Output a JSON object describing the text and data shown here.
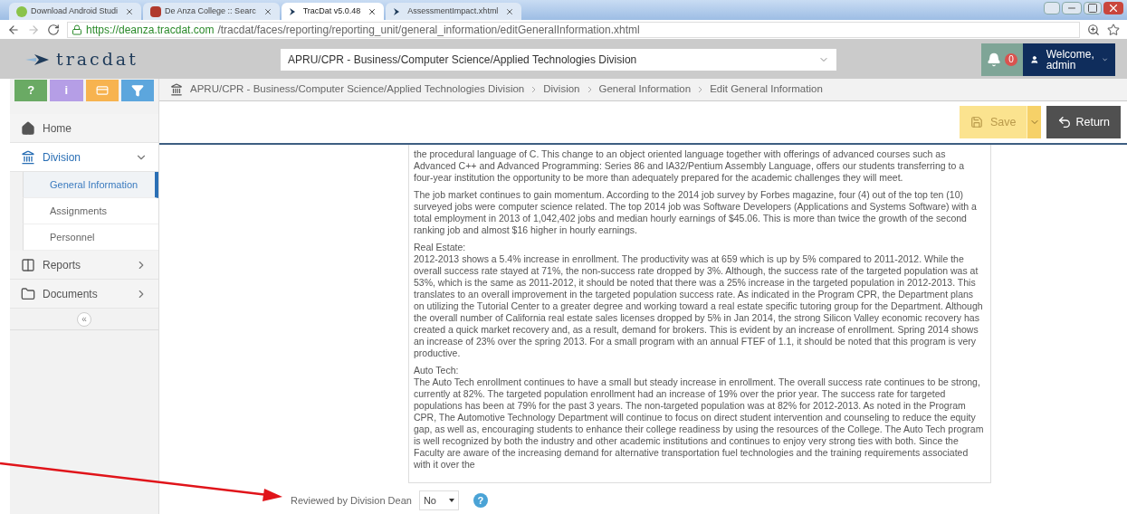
{
  "browser": {
    "tabs": [
      {
        "title": "Download Android Studi",
        "selected": false,
        "kind": "android"
      },
      {
        "title": "De Anza College :: Searc",
        "selected": false,
        "kind": "doc"
      },
      {
        "title": "TracDat v5.0.48",
        "selected": true,
        "kind": "tracdat"
      },
      {
        "title": "AssessmentImpact.xhtml",
        "selected": false,
        "kind": "tracdat"
      }
    ],
    "url": {
      "host": "https://deanza.tracdat.com",
      "path": "/tracdat/faces/reporting/reporting_unit/general_information/editGeneralInformation.xhtml"
    }
  },
  "header": {
    "logo": "tracdat",
    "unit_select": "APRU/CPR - Business/Computer Science/Applied Technologies Division",
    "notifications": "0",
    "welcome": "Welcome,",
    "user": "admin"
  },
  "quick_buttons": [
    {
      "kind": "text",
      "label": "?",
      "color": "#6aaa64"
    },
    {
      "kind": "text",
      "label": "i",
      "color": "#b59ee6"
    },
    {
      "kind": "card",
      "color": "#f7b34f"
    },
    {
      "kind": "filter",
      "color": "#5ca6dd"
    }
  ],
  "breadcrumb": [
    "APRU/CPR - Business/Computer Science/Applied Technologies Division",
    "Division",
    "General Information",
    "Edit General Information"
  ],
  "sidebar": {
    "items": [
      {
        "label": "Home",
        "kind": "home",
        "selected": false
      },
      {
        "label": "Division",
        "kind": "bank",
        "selected": true,
        "expanded": true,
        "children": [
          {
            "label": "General Information",
            "selected": true
          },
          {
            "label": "Assignments",
            "selected": false
          },
          {
            "label": "Personnel",
            "selected": false
          }
        ]
      },
      {
        "label": "Reports",
        "kind": "columns",
        "selected": false,
        "expanded": false
      },
      {
        "label": "Documents",
        "kind": "folder",
        "selected": false,
        "expanded": false
      }
    ],
    "collapse": "«"
  },
  "toolbar": {
    "save": "Save",
    "return": "Return"
  },
  "editor": {
    "paragraphs": [
      {
        "text": "the procedural language of C. This change to an object oriented language together with offerings of advanced courses such as Advanced C++ and Advanced Programming: Series 86 and IA32/Pentium Assembly Language, offers our students transferring to a four-year institution the opportunity to be more than adequately prepared for the academic challenges they will meet."
      },
      {
        "text": "The job market continues to gain momentum.   According to the 2014 job survey by Forbes magazine, four (4) out of the top ten (10) surveyed jobs were computer science related.  The top 2014 job was Software Developers (Applications and Systems Software) with a total employment in 2013 of 1,042,402 jobs and median hourly earnings of $45.06. This is more than twice the growth of the second ranking job and almost $16 higher in hourly earnings."
      },
      {
        "heading": "Real Estate:",
        "text": "2012-2013 shows a 5.4% increase in enrollment. The productivity was at 659 which is up by 5% compared to 2011-2012.   While the overall success rate stayed at 71%, the non-success rate dropped by 3%.  Although, the success rate of the targeted population was at 53%, which is the same as 2011-2012, it should be noted that there was a 25% increase in the targeted population in 2012-2013.  This translates to an overall improvement in the targeted population success rate.  As indicated in the Program CPR, the Department plans on utilizing the Tutorial Center to a greater degree and working toward a real estate specific tutoring group for the Department.  Although the overall number of California real estate sales licenses dropped by 5% in Jan 2014, the strong Silicon Valley economic recovery has created a quick market recovery and, as a result, demand for brokers.  This is evident by an increase of enrollment.  Spring 2014 shows an increase of 23% over the spring 2013.  For a small program with an annual FTEF of 1.1, it should be noted that this program is very productive."
      },
      {
        "heading": "Auto Tech:",
        "text": "The Auto Tech enrollment continues to have a small but steady increase in enrollment.  The overall success rate continues to be strong, currently at 82%.  The targeted population enrollment had an increase of 19% over the prior year.  The success rate for targeted populations has been at 79% for the past 3 years.  The non-targeted population was at 82% for 2012-2013.  As noted in the Program CPR, The Automotive Technology Department will continue to focus on direct student intervention and counseling to reduce the equity gap, as well as, encouraging students to enhance their college readiness by using the resources of the College.  The Auto Tech program is well recognized by both the industry and other academic institutions and continues to enjoy very strong ties with both.  Since the Faculty are aware of the increasing demand for alternative transportation fuel technologies and the training requirements associated with it over the"
      }
    ]
  },
  "review": {
    "label": "Reviewed by Division Dean",
    "value": "No",
    "help": "?"
  }
}
